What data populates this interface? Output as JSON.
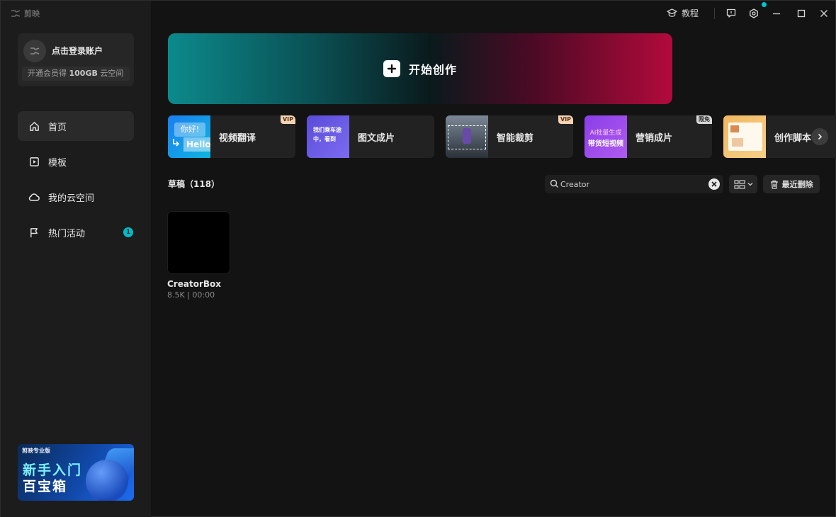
{
  "app": {
    "name": "剪映"
  },
  "account": {
    "login_label": "点击登录账户",
    "member_prefix": "开通会员得",
    "member_highlight": "100GB",
    "member_suffix": "云空间"
  },
  "sidebar": {
    "items": [
      {
        "label": "首页",
        "icon": "home-icon",
        "active": true
      },
      {
        "label": "模板",
        "icon": "template-icon"
      },
      {
        "label": "我的云空间",
        "icon": "cloud-icon"
      },
      {
        "label": "热门活动",
        "icon": "flag-icon",
        "badge": "1"
      }
    ]
  },
  "promo": {
    "brand": "剪映专业版",
    "line1": "新手入门",
    "line2": "百宝箱"
  },
  "titlebar": {
    "tutorial_label": "教程",
    "accent": "#00c4cf"
  },
  "hero": {
    "label": "开始创作"
  },
  "tools": [
    {
      "label": "视频翻译",
      "tag": "VIP",
      "thumb_text_top": "你好!",
      "thumb_text_bottom": "Hello"
    },
    {
      "label": "图文成片",
      "thumb_text": "我们乘车途中，看到"
    },
    {
      "label": "智能裁剪",
      "tag": "VIP"
    },
    {
      "label": "营销成片",
      "tag": "限免",
      "thumb_line1": "AI批量生成",
      "thumb_line2": "带货短视频"
    },
    {
      "label": "创作脚本"
    }
  ],
  "drafts": {
    "title": "草稿（118）"
  },
  "search": {
    "value": "Creator"
  },
  "trash": {
    "label": "最近删除"
  },
  "projects": [
    {
      "name": "CreatorBox",
      "meta": "8.5K | 00:00"
    }
  ]
}
